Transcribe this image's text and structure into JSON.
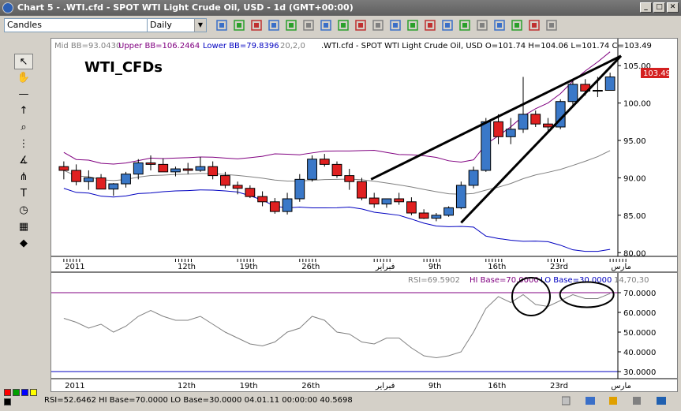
{
  "window": {
    "title": "Chart 5 - .WTI.cfd - SPOT WTI Light Crude Oil, USD - 1d (GMT+00:00)",
    "buttons": [
      "_",
      "□",
      "✕"
    ]
  },
  "toolbar": {
    "chart_type": "Candles",
    "period": "Daily",
    "icons": [
      "new-chart-icon",
      "template-icon",
      "zoom-in-icon",
      "zoom-out-icon",
      "chart-type-icon",
      "grid-icon",
      "indicator-icon",
      "cursor-icon",
      "period-icon",
      "scroll-icon",
      "shift-icon",
      "objects-icon",
      "save-icon",
      "print-icon",
      "properties-icon",
      "refresh-icon",
      "link-icon",
      "add-icon",
      "remove-icon",
      "settings-icon"
    ]
  },
  "left_tools": [
    "pointer-icon",
    "hand-icon",
    "line-icon",
    "arrow-up-icon",
    "magnifier-icon",
    "grid-lines-icon",
    "fan-icon",
    "fork-icon",
    "text-icon",
    "alarm-icon",
    "calculator-icon",
    "palette-icon"
  ],
  "main": {
    "indicator_label_mid": "Mid BB=93.0430",
    "indicator_label_upper": "Upper BB=106.2464",
    "indicator_label_lower": "Lower BB=79.8396",
    "indicator_params": "20,2,0",
    "symbol_info": ".WTI.cfd - SPOT WTI Light Crude Oil, USD O=101.74 H=104.06 L=101.74 C=103.49",
    "watermark": "WTI_CFDs",
    "price_badge": "103.49",
    "price_badge_color": "#d42020",
    "y_ticks": [
      "105.00",
      "100.00",
      "95.00",
      "90.00",
      "85.00",
      "80.00"
    ],
    "x_ticks": [
      "2011",
      "12th",
      "19th",
      "26th",
      "فبراير",
      "9th",
      "16th",
      "23rd",
      "مارس"
    ]
  },
  "rsi": {
    "label": "RSI=69.5902",
    "hi_label": "HI Base=70.0000",
    "lo_label": "LO Base=30.0000",
    "params": "14,70,30",
    "y_ticks": [
      "70.0000",
      "60.0000",
      "50.0000",
      "40.0000",
      "30.0000"
    ],
    "x_ticks": [
      "2011",
      "12th",
      "19th",
      "26th",
      "فبراير",
      "9th",
      "16th",
      "23rd",
      "مارس"
    ]
  },
  "status": {
    "text": "RSI=52.6462 HI Base=70.0000 LO Base=30.0000   04.01.11 00:00:00 40.5698",
    "swatches": [
      "#ff0000",
      "#00a000",
      "#0000ff",
      "#ffff00",
      "#000000"
    ]
  },
  "chart_data": [
    {
      "type": "candlestick",
      "title": ".WTI.cfd - SPOT WTI Light Crude Oil, USD",
      "ylim": [
        79.5,
        106.5
      ],
      "x": [
        "2011-01-03",
        "2011-01-04",
        "2011-01-05",
        "2011-01-06",
        "2011-01-07",
        "2011-01-10",
        "2011-01-11",
        "2011-01-12",
        "2011-01-13",
        "2011-01-14",
        "2011-01-17",
        "2011-01-18",
        "2011-01-19",
        "2011-01-20",
        "2011-01-21",
        "2011-01-24",
        "2011-01-25",
        "2011-01-26",
        "2011-01-27",
        "2011-01-28",
        "2011-01-31",
        "2011-02-01",
        "2011-02-02",
        "2011-02-03",
        "2011-02-04",
        "2011-02-07",
        "2011-02-08",
        "2011-02-09",
        "2011-02-10",
        "2011-02-11",
        "2011-02-14",
        "2011-02-15",
        "2011-02-16",
        "2011-02-17",
        "2011-02-18",
        "2011-02-21",
        "2011-02-22",
        "2011-02-23",
        "2011-02-24",
        "2011-02-25",
        "2011-02-28",
        "2011-03-01",
        "2011-03-02",
        "2011-03-03",
        "2011-03-04"
      ],
      "open": [
        91.5,
        91.0,
        89.5,
        90.0,
        88.5,
        89.2,
        90.5,
        92.0,
        91.8,
        90.8,
        91.2,
        91.0,
        91.5,
        90.3,
        89.0,
        88.6,
        87.5,
        86.8,
        85.5,
        87.2,
        89.8,
        92.5,
        91.8,
        90.3,
        89.5,
        87.3,
        86.5,
        87.2,
        86.8,
        85.3,
        84.6,
        85.0,
        86.0,
        89.0,
        91.0,
        97.5,
        95.5,
        96.5,
        98.5,
        97.2,
        96.8,
        100.2,
        102.5,
        101.6,
        101.7
      ],
      "high": [
        92.2,
        91.8,
        91.0,
        90.5,
        89.3,
        90.8,
        92.5,
        93.0,
        92.6,
        91.5,
        92.0,
        92.8,
        92.2,
        90.8,
        89.5,
        89.0,
        88.2,
        87.3,
        88.0,
        90.5,
        93.0,
        93.2,
        92.2,
        91.2,
        90.0,
        88.0,
        87.2,
        88.0,
        87.4,
        85.8,
        85.3,
        86.2,
        89.5,
        91.5,
        98.0,
        98.5,
        98.0,
        103.5,
        99.0,
        98.0,
        100.5,
        103.0,
        103.2,
        103.5,
        104.06
      ],
      "low": [
        89.8,
        89.0,
        88.4,
        88.8,
        87.6,
        88.7,
        89.8,
        91.0,
        90.8,
        90.2,
        90.5,
        90.8,
        89.8,
        88.6,
        87.8,
        87.3,
        86.2,
        85.2,
        85.1,
        86.8,
        89.5,
        91.5,
        90.0,
        88.4,
        87.0,
        86.0,
        86.0,
        86.4,
        85.0,
        84.5,
        84.2,
        84.8,
        85.8,
        88.6,
        90.8,
        94.5,
        94.5,
        96.0,
        96.8,
        96.0,
        96.5,
        99.5,
        101.0,
        100.8,
        101.7
      ],
      "close": [
        91.0,
        89.5,
        90.0,
        88.5,
        89.2,
        90.5,
        92.0,
        91.8,
        90.8,
        91.2,
        91.0,
        91.5,
        90.3,
        89.0,
        88.6,
        87.5,
        86.8,
        85.5,
        87.2,
        89.8,
        92.5,
        91.8,
        90.3,
        89.5,
        87.3,
        86.5,
        87.2,
        86.8,
        85.3,
        84.6,
        85.0,
        86.0,
        89.0,
        91.0,
        97.5,
        95.5,
        96.5,
        98.5,
        97.2,
        96.8,
        100.2,
        102.5,
        101.6,
        101.7,
        103.49
      ],
      "bollinger": {
        "period": 20,
        "mid": 93.043,
        "upper": 106.2464,
        "lower": 79.8396
      }
    },
    {
      "type": "line",
      "title": "RSI(14)",
      "ylim": [
        28,
        74
      ],
      "hi_base": 70,
      "lo_base": 30,
      "values": [
        57,
        55,
        52,
        54,
        50,
        53,
        58,
        61,
        58,
        56,
        56,
        58,
        54,
        50,
        47,
        44,
        43,
        45,
        50,
        52,
        58,
        56,
        50,
        49,
        45,
        44,
        47,
        47,
        42,
        38,
        37,
        38,
        40,
        50,
        62,
        68,
        65,
        69,
        64,
        63,
        66,
        69,
        67,
        67,
        69.59
      ]
    }
  ]
}
